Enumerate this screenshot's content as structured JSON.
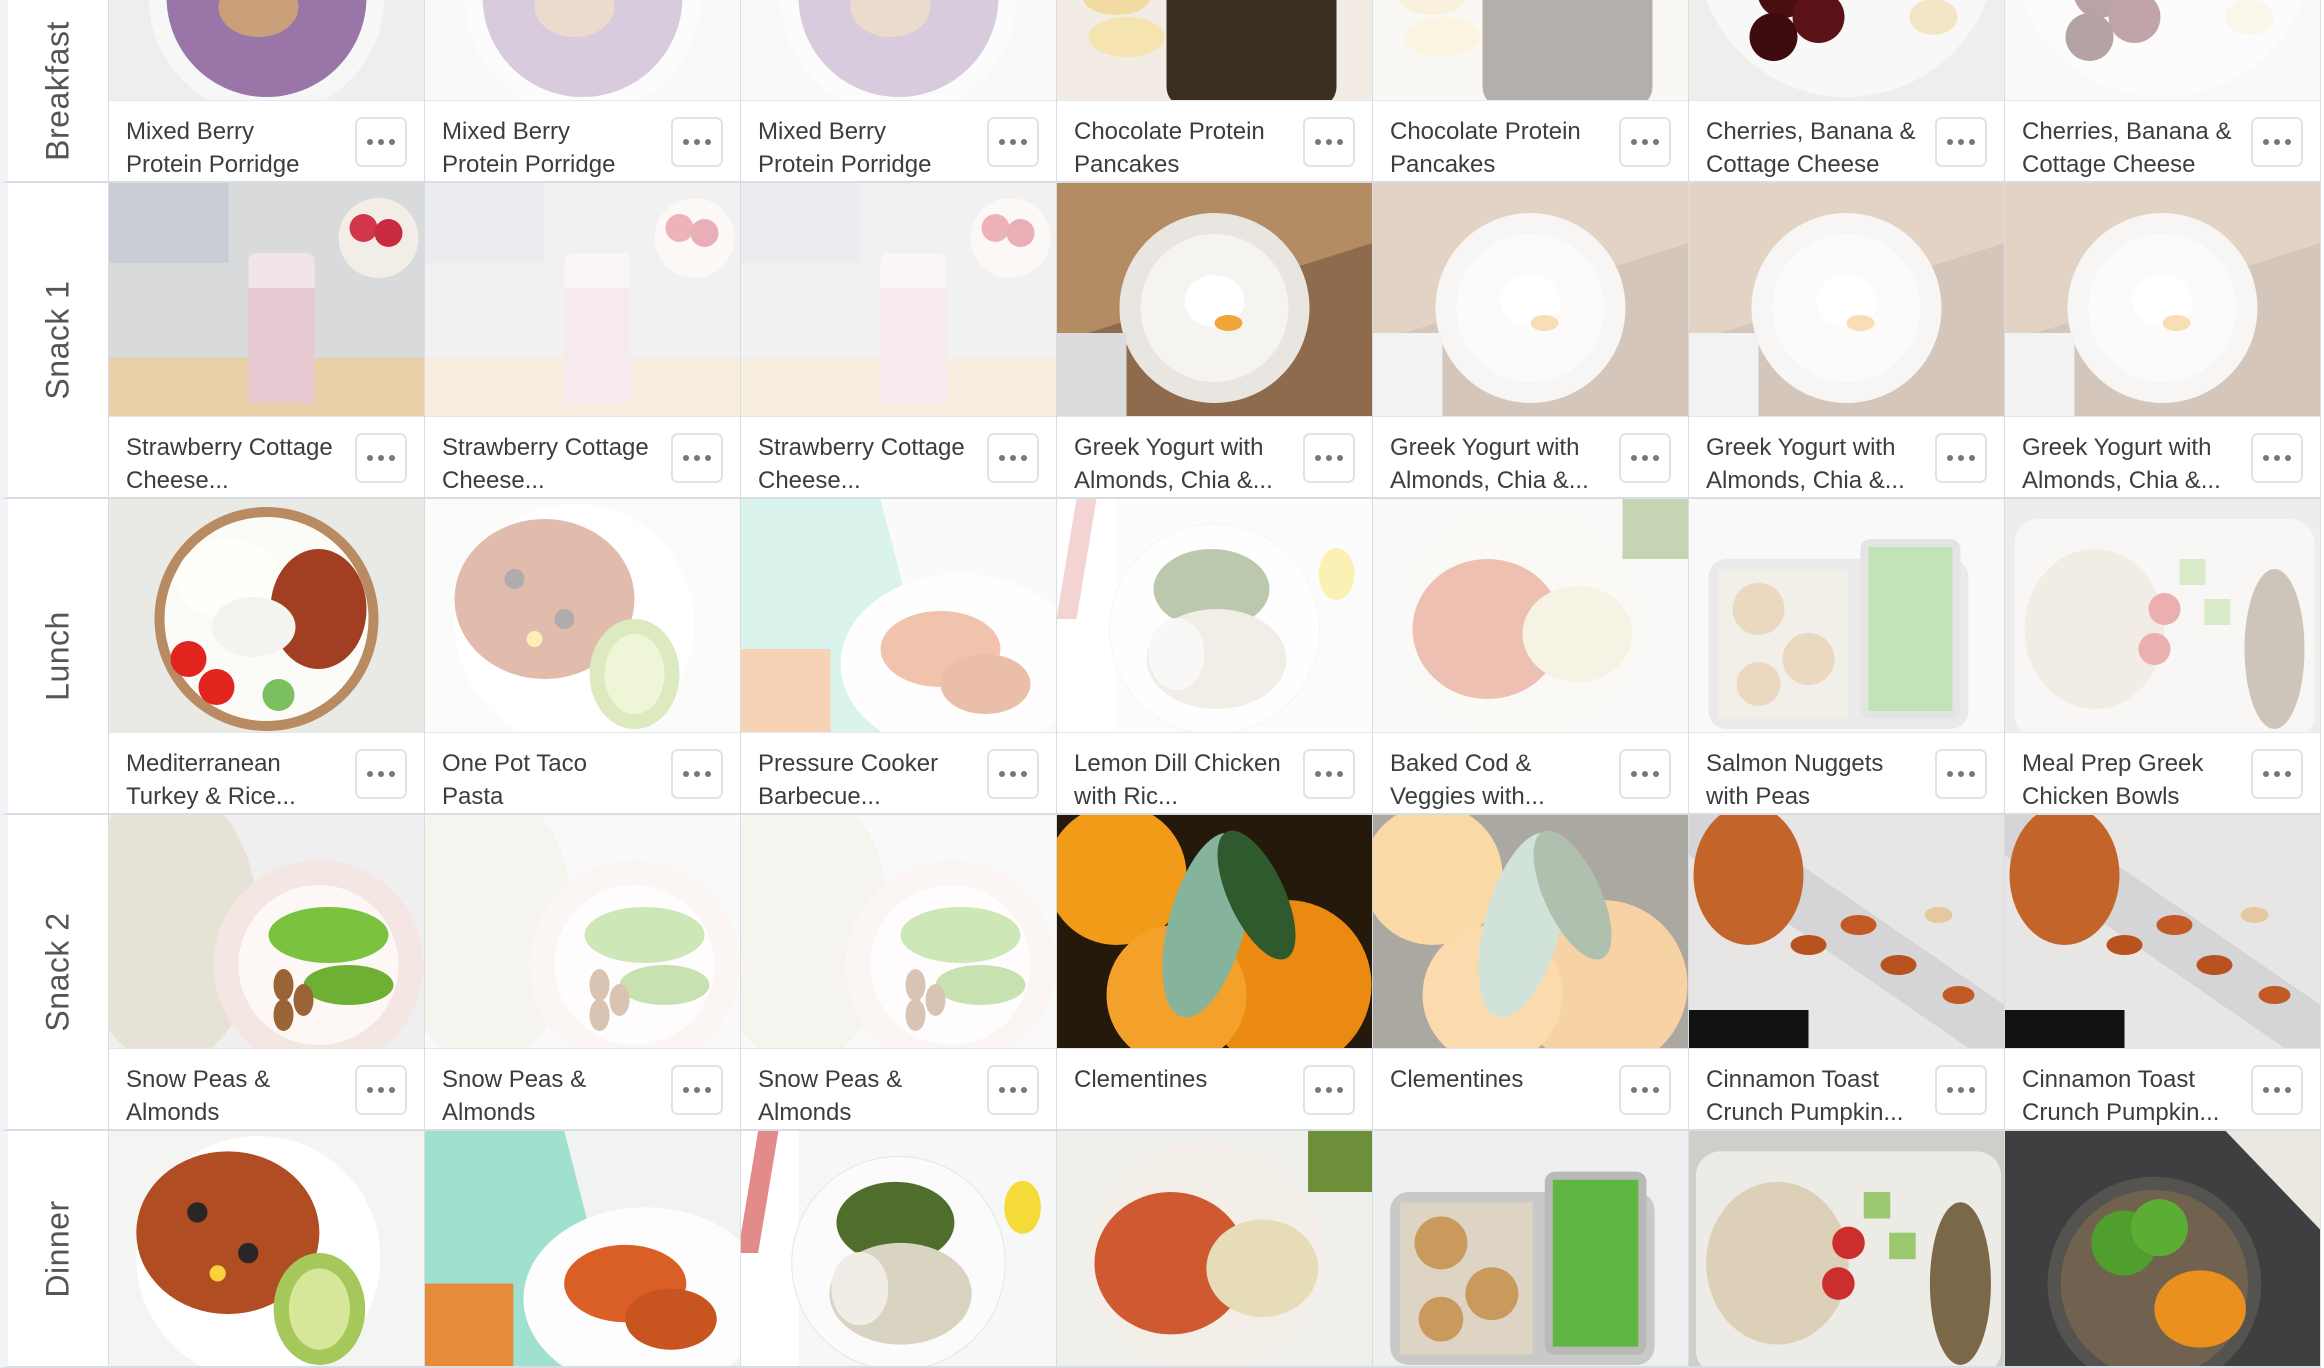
{
  "rows": [
    {
      "label": "Breakfast",
      "meals": [
        {
          "title": "Mixed Berry Protein Porridge",
          "img": "porridge",
          "dim": false
        },
        {
          "title": "Mixed Berry Protein Porridge",
          "img": "porridge",
          "dim": true
        },
        {
          "title": "Mixed Berry Protein Porridge",
          "img": "porridge",
          "dim": true
        },
        {
          "title": "Chocolate Protein Pancakes",
          "img": "pancakes",
          "dim": false
        },
        {
          "title": "Chocolate Protein Pancakes",
          "img": "pancakes",
          "dim": true
        },
        {
          "title": "Cherries, Banana & Cottage Cheese",
          "img": "cherries",
          "dim": false
        },
        {
          "title": "Cherries, Banana & Cottage Cheese",
          "img": "cherries",
          "dim": true
        }
      ]
    },
    {
      "label": "Snack 1",
      "meals": [
        {
          "title": "Strawberry Cottage Cheese...",
          "img": "shake",
          "dim": false
        },
        {
          "title": "Strawberry Cottage Cheese...",
          "img": "shake",
          "dim": true
        },
        {
          "title": "Strawberry Cottage Cheese...",
          "img": "shake",
          "dim": true
        },
        {
          "title": "Greek Yogurt with Almonds, Chia &...",
          "img": "yogurt",
          "dim": false
        },
        {
          "title": "Greek Yogurt with Almonds, Chia &...",
          "img": "yogurt",
          "dim": true
        },
        {
          "title": "Greek Yogurt with Almonds, Chia &...",
          "img": "yogurt",
          "dim": true
        },
        {
          "title": "Greek Yogurt with Almonds, Chia &...",
          "img": "yogurt",
          "dim": true
        }
      ]
    },
    {
      "label": "Lunch",
      "meals": [
        {
          "title": "Mediterranean Turkey & Rice...",
          "img": "bowl",
          "dim": false
        },
        {
          "title": "One Pot Taco Pasta",
          "img": "taco",
          "dim": true
        },
        {
          "title": "Pressure Cooker Barbecue...",
          "img": "bbq",
          "dim": true
        },
        {
          "title": "Lemon Dill Chicken with Ric...",
          "img": "lemon",
          "dim": true
        },
        {
          "title": "Baked Cod & Veggies with...",
          "img": "cod",
          "dim": true
        },
        {
          "title": "Salmon Nuggets with Peas",
          "img": "nuggets",
          "dim": true
        },
        {
          "title": "Meal Prep Greek Chicken Bowls",
          "img": "greek",
          "dim": true
        }
      ]
    },
    {
      "label": "Snack 2",
      "meals": [
        {
          "title": "Snow Peas & Almonds",
          "img": "peas",
          "dim": false
        },
        {
          "title": "Snow Peas & Almonds",
          "img": "peas",
          "dim": true
        },
        {
          "title": "Snow Peas & Almonds",
          "img": "peas",
          "dim": true
        },
        {
          "title": "Clementines",
          "img": "clementine",
          "dim": false
        },
        {
          "title": "Clementines",
          "img": "clementine",
          "dim": true
        },
        {
          "title": "Cinnamon Toast Crunch Pumpkin...",
          "img": "seeds",
          "dim": false
        },
        {
          "title": "Cinnamon Toast Crunch Pumpkin...",
          "img": "seeds",
          "dim": false
        }
      ]
    },
    {
      "label": "Dinner",
      "meals": [
        {
          "title": "",
          "img": "taco",
          "dim": false
        },
        {
          "title": "",
          "img": "bbq",
          "dim": false
        },
        {
          "title": "",
          "img": "lemon",
          "dim": false
        },
        {
          "title": "",
          "img": "cod",
          "dim": false
        },
        {
          "title": "",
          "img": "nuggets",
          "dim": false
        },
        {
          "title": "",
          "img": "greek",
          "dim": false
        },
        {
          "title": "",
          "img": "broccoli",
          "dim": false
        }
      ]
    }
  ]
}
